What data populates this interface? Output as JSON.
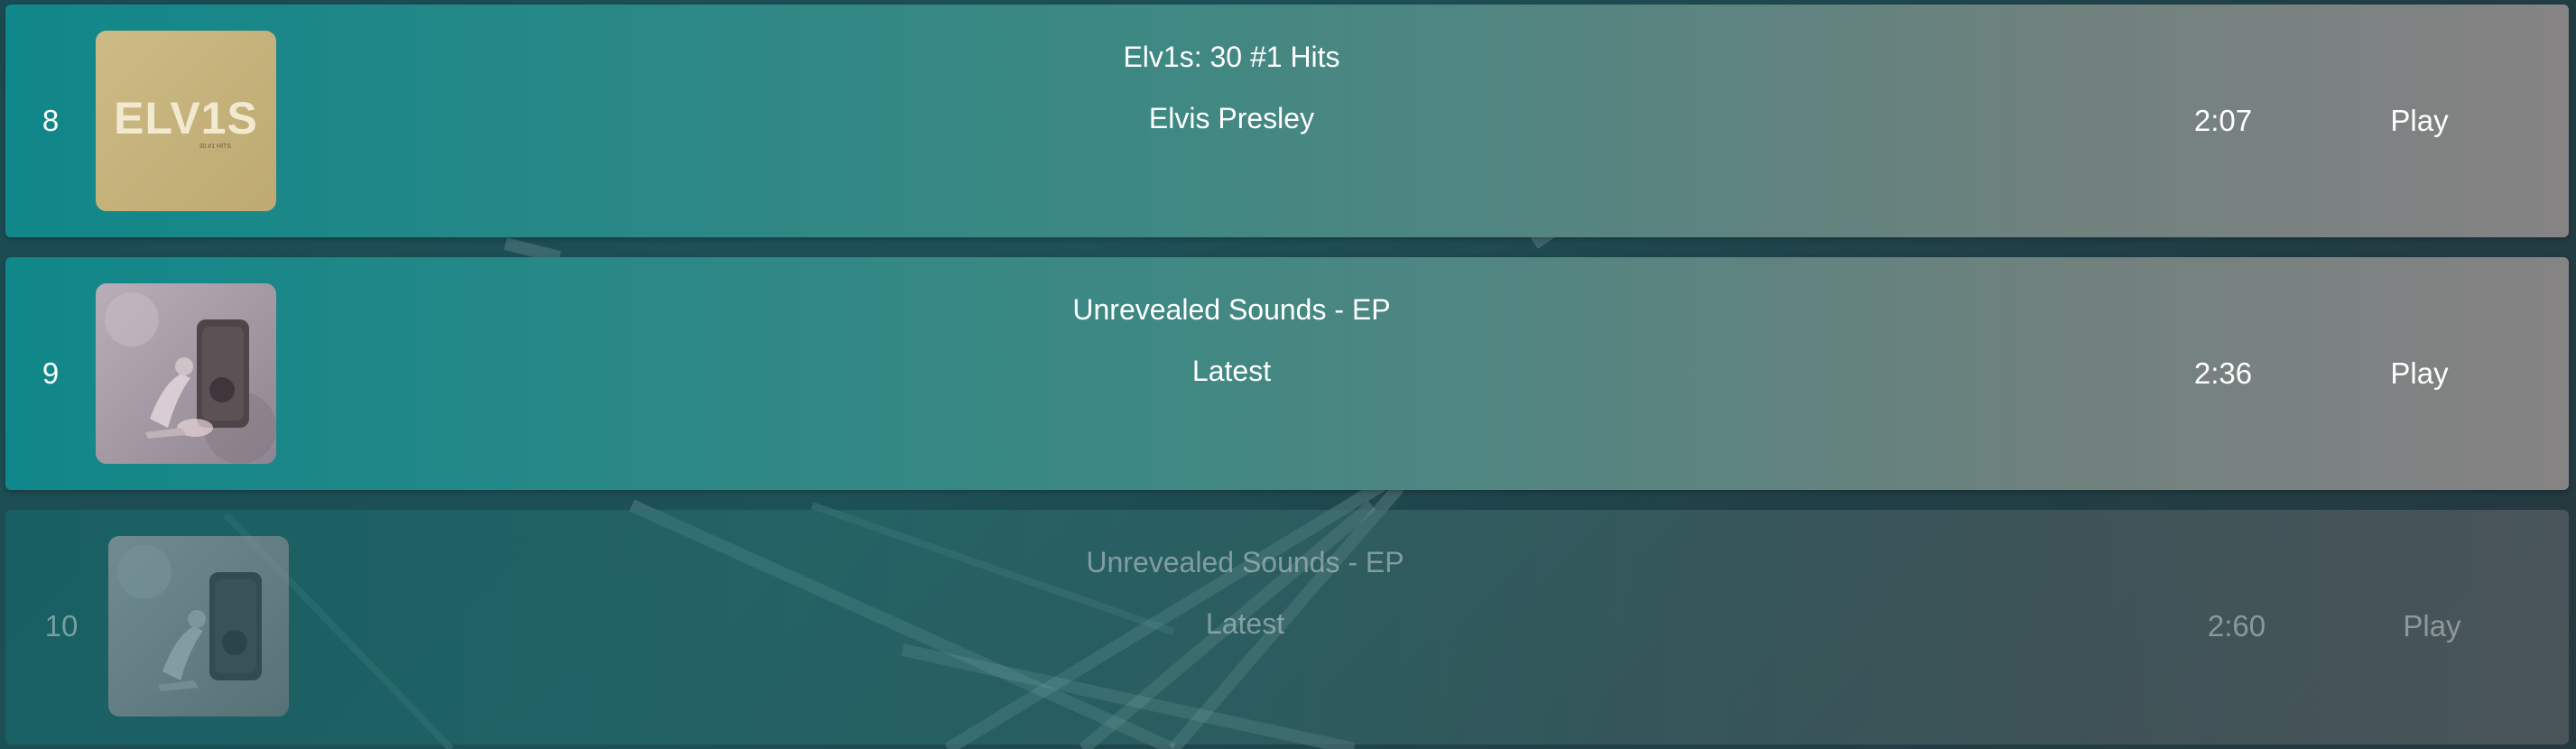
{
  "colors": {
    "row_gradient_start": "#10878a",
    "row_gradient_end": "#868384",
    "text": "#ffffff",
    "faded_text": "#c8d2d2"
  },
  "tracks": [
    {
      "number": "8",
      "title": "Elv1s: 30 #1 Hits",
      "artist": "Elvis Presley",
      "duration": "2:07",
      "action_label": "Play",
      "artwork": {
        "icon": "album-artwork-elvis",
        "logo_text": "ELV1S",
        "subtitle_text": "30 #1 HITS",
        "background": "#c5b27a"
      }
    },
    {
      "number": "9",
      "title": "Unrevealed Sounds - EP",
      "artist": "Latest",
      "duration": "2:36",
      "action_label": "Play",
      "artwork": {
        "icon": "album-artwork-person-speaker",
        "background": "#a89ca6"
      }
    },
    {
      "number": "10",
      "title": "Unrevealed Sounds - EP",
      "artist": "Latest",
      "duration": "2:60",
      "action_label": "Play",
      "artwork": {
        "icon": "album-artwork-person-speaker",
        "background": "#8a8a8e"
      }
    }
  ]
}
